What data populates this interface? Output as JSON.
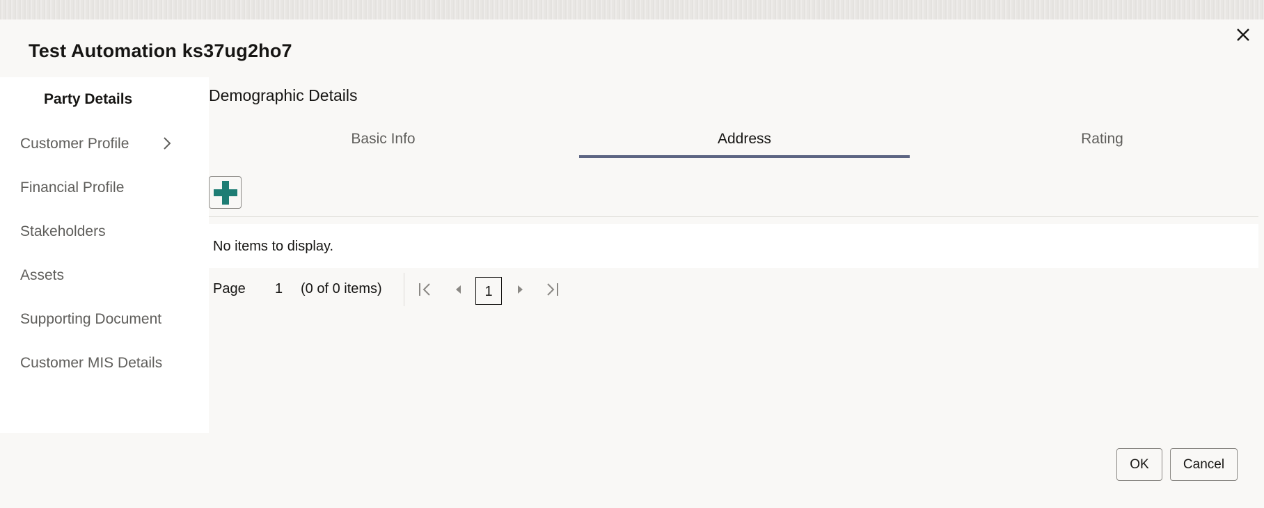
{
  "dialog": {
    "title": "Test Automation ks37ug2ho7",
    "close_icon": "close-icon"
  },
  "sidebar": {
    "header": "Party Details",
    "items": [
      {
        "label": "Customer Profile",
        "has_submenu": true
      },
      {
        "label": "Financial Profile"
      },
      {
        "label": "Stakeholders"
      },
      {
        "label": "Assets"
      },
      {
        "label": "Supporting Document"
      },
      {
        "label": "Customer MIS Details"
      }
    ]
  },
  "main": {
    "section_title": "Demographic Details",
    "tabs": [
      {
        "label": "Basic Info"
      },
      {
        "label": "Address",
        "active": true
      },
      {
        "label": "Rating"
      }
    ],
    "add_icon": "plus-icon",
    "empty_message": "No items to display.",
    "pager": {
      "page_label": "Page",
      "page_value": "1",
      "items_text": "(0 of 0 items)",
      "current_page": "1"
    }
  },
  "footer": {
    "ok_label": "OK",
    "cancel_label": "Cancel"
  },
  "colors": {
    "accent_tab": "#5d6583",
    "add_icon": "#1e7d74"
  }
}
